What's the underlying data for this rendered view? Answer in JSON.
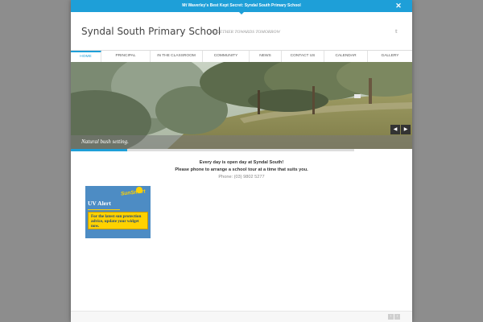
{
  "announcement": {
    "text": "Mt Waverley's Best Kept Secret: Syndal South Primary School",
    "close_label": "✕"
  },
  "header": {
    "site_title": "Syndal South Primary School",
    "tagline": "TOGETHER TOWARDS TOMORROW",
    "social_icon": "twitter-icon",
    "social_text": "𝕥"
  },
  "nav": {
    "items": [
      {
        "label": "HOME",
        "active": true
      },
      {
        "label": "PRINCIPAL",
        "active": false
      },
      {
        "label": "IN THE CLASSROOM",
        "active": false
      },
      {
        "label": "COMMUNITY",
        "active": false
      },
      {
        "label": "NEWS",
        "active": false
      },
      {
        "label": "CONTACT US",
        "active": false
      },
      {
        "label": "CALENDAR",
        "active": false
      },
      {
        "label": "GALLERY",
        "active": false
      }
    ]
  },
  "slider": {
    "caption": "Natural bush setting.",
    "prev": "◀",
    "next": "▶",
    "progress_fraction": 0.2
  },
  "intro": {
    "line1": "Every day is open day at Syndal South!",
    "line2": "Please phone to arrange a school tour at a time that suits you.",
    "phone": "Phone: (03) 9802 5277"
  },
  "uv_widget": {
    "title": "UV Alert",
    "brand": "SunSmart",
    "message": "For the latest sun protection advice, update your widget now."
  },
  "footer": {
    "prev": "‹",
    "next": "›"
  },
  "colors": {
    "accent": "#1e9fd8",
    "uv_blue": "#4d8cc4",
    "uv_yellow": "#ffd200"
  }
}
